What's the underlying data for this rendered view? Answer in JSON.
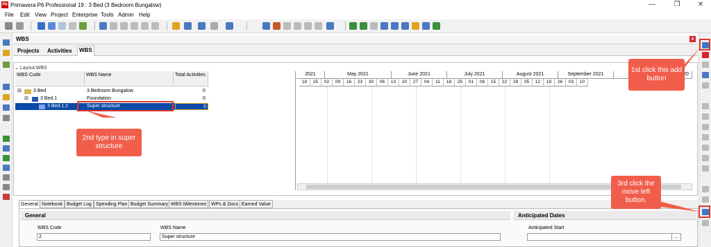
{
  "window": {
    "logo": "P6",
    "title": "Primavera P6 Professional 19 : 3  Bed (3 Bedroom Bungalow)",
    "minimize": "—",
    "restore": "❐",
    "close": "✕"
  },
  "menu": [
    "File",
    "Edit",
    "View",
    "Project",
    "Enterprise",
    "Tools",
    "Admin",
    "Help"
  ],
  "panel": {
    "title": "WBS",
    "close_glyph": "x",
    "tabs": [
      "Projects",
      "Activities",
      "WBS"
    ],
    "active_tab": "WBS",
    "layout_label": "Layout:WBS"
  },
  "table": {
    "headers": [
      "WBS Code",
      "WBS Name",
      "Total Activities"
    ],
    "rows": [
      {
        "code": "3  Bed",
        "name": "3 Bedroom Bungalow",
        "total": "0"
      },
      {
        "code": "3  Bed.1",
        "name": "Foundation",
        "total": "0"
      },
      {
        "code": "3  Bed.1.2",
        "name": "Super structure",
        "total": "0"
      }
    ]
  },
  "gantt": {
    "months": [
      "2021",
      "May 2021",
      "June 2021",
      "July 2021",
      "August 2021",
      "September 2021",
      "October",
      "20"
    ],
    "days": [
      "18",
      "25",
      "02",
      "09",
      "16",
      "23",
      "30",
      "06",
      "13",
      "20",
      "27",
      "04",
      "11",
      "18",
      "25",
      "01",
      "08",
      "15",
      "22",
      "29",
      "05",
      "12",
      "19",
      "26",
      "03",
      "10"
    ]
  },
  "detail": {
    "tabs": [
      "General",
      "Notebook",
      "Budget Log",
      "Spending Plan",
      "Budget Summary",
      "WBS Milestones",
      "WPs & Docs",
      "Earned Value"
    ],
    "general_header": "General",
    "anticipated_header": "Anticipated Dates",
    "wbs_code_label": "WBS Code",
    "wbs_code_value": "2",
    "wbs_name_label": "WBS Name",
    "wbs_name_value": "Super structure",
    "anticipated_start_label": "Anticipated Start",
    "ellipsis": "..."
  },
  "annotations": {
    "step1": "1st click this add button",
    "step2": "2nd type in super structure",
    "step3": "3rd click the move left button."
  },
  "colors": {
    "selection": "#0a4aa8",
    "callout": "#f05e4b",
    "highlight_border": "#e2352a"
  }
}
